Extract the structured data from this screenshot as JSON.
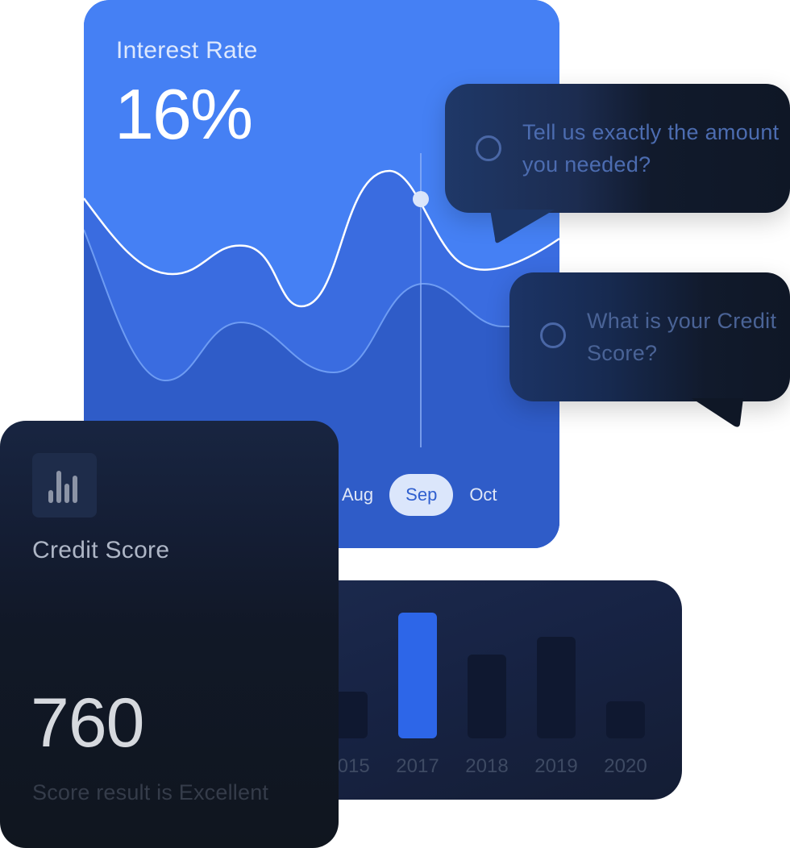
{
  "interest_card": {
    "title": "Interest Rate",
    "value": "16%",
    "months": [
      "Aug",
      "Sep",
      "Oct"
    ],
    "selected_month": "Sep"
  },
  "questions": {
    "q1": "Tell us exactly the amount you needed?",
    "q2": "What is your Credit Score?"
  },
  "credit_card": {
    "icon": "bar-chart-icon",
    "title": "Credit Score",
    "score": "760",
    "note": "Score result is Excellent"
  },
  "year_bars": {
    "categories": [
      "2015",
      "2017",
      "2018",
      "2019",
      "2020"
    ],
    "values": [
      0.29,
      0.78,
      0.52,
      0.63,
      0.23
    ],
    "highlight": "2017"
  },
  "colors": {
    "accent": "#3061d2",
    "accent_light": "#4580f4",
    "dark": "#111827",
    "bar_highlight": "#2d66e8",
    "bar_default": "#0f1830"
  }
}
